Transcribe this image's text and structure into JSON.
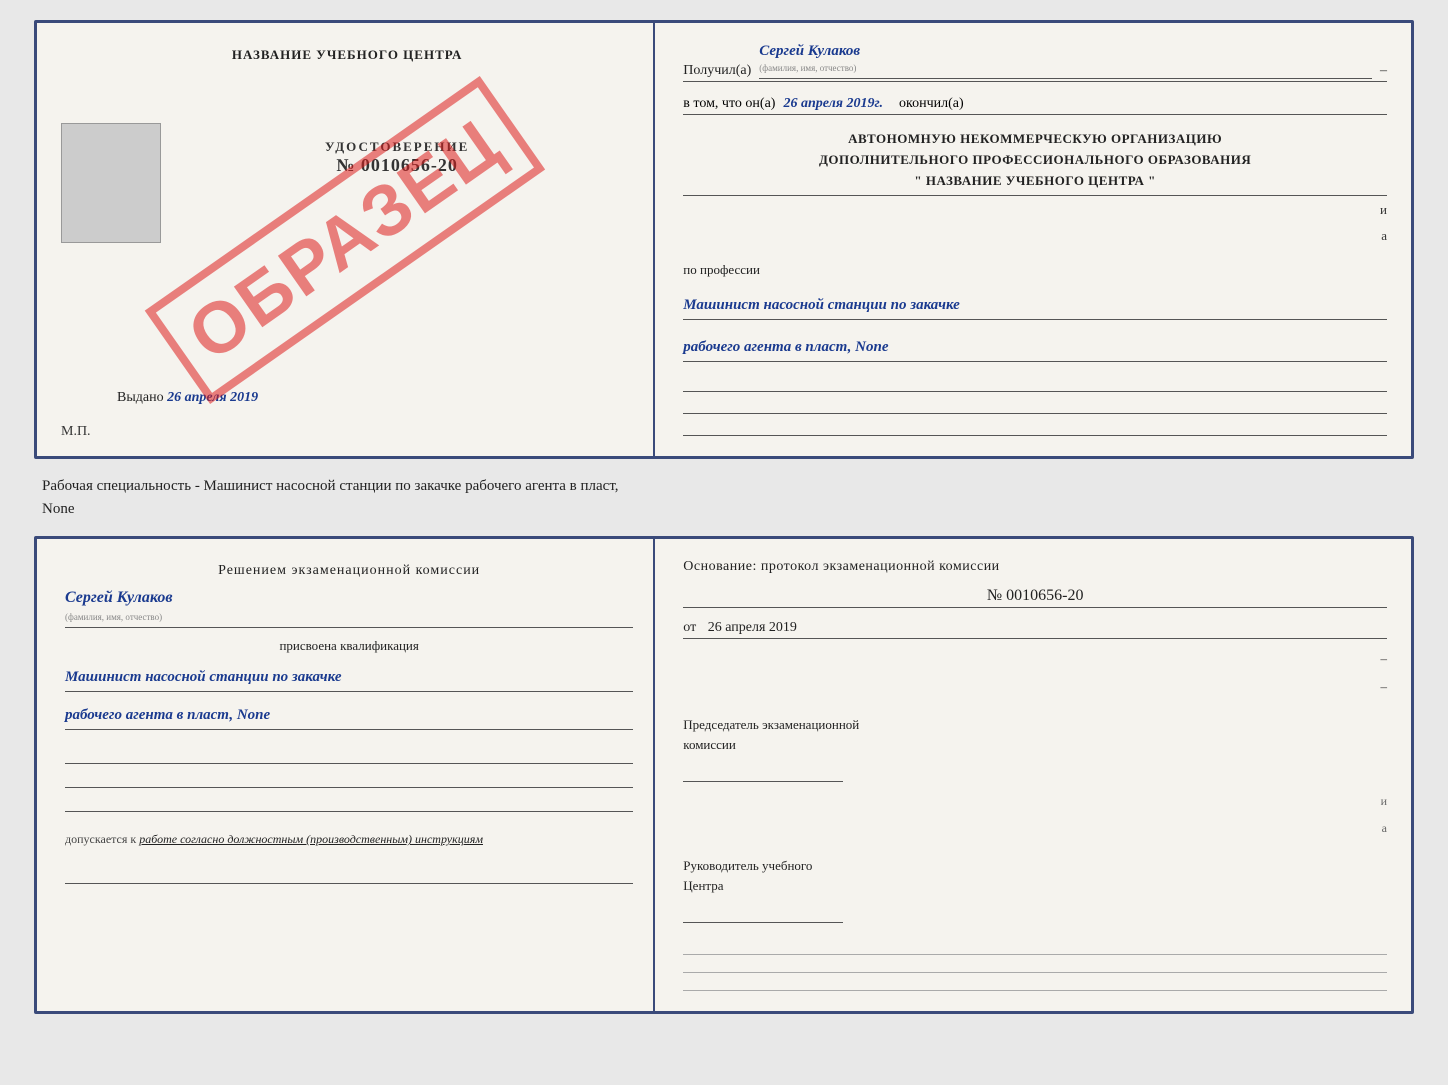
{
  "top_booklet": {
    "left": {
      "center_title": "НАЗВАНИЕ УЧЕБНОГО ЦЕНТРА",
      "udc_label": "УДОСТОВЕРЕНИЕ",
      "udc_number": "№ 0010656-20",
      "vydano_label": "Выдано",
      "vydano_date": "26 апреля 2019",
      "mp_label": "М.П.",
      "watermark": "ОБРАЗЕЦ"
    },
    "right": {
      "poluchil_label": "Получил(а)",
      "poluchil_value": "Сергей Кулаков",
      "poluchil_sub": "(фамилия, имя, отчество)",
      "dash1": "–",
      "vtom_label": "в том, что он(а)",
      "vtom_date": "26 апреля 2019г.",
      "okonchil_label": "окончил(а)",
      "org_line1": "АВТОНОМНУЮ НЕКОММЕРЧЕСКУЮ ОРГАНИЗАЦИЮ",
      "org_line2": "ДОПОЛНИТЕЛЬНОГО ПРОФЕССИОНАЛЬНОГО ОБРАЗОВАНИЯ",
      "org_line3": "\" НАЗВАНИЕ УЧЕБНОГО ЦЕНТРА \"",
      "dash_i": "и",
      "dash_a": "а",
      "po_professii": "по профессии",
      "profession_line1": "Машинист насосной станции по закачке",
      "profession_line2": "рабочего агента в пласт, None"
    }
  },
  "middle_text": {
    "line1": "Рабочая специальность - Машинист насосной станции по закачке рабочего агента в пласт,",
    "line2": "None"
  },
  "bottom_booklet": {
    "left": {
      "resolution_title": "Решением  экзаменационной  комиссии",
      "name_value": "Сергей Кулаков",
      "name_sub": "(фамилия, имя, отчество)",
      "prisvoena": "присвоена квалификация",
      "qual_line1": "Машинист насосной станции по закачке",
      "qual_line2": "рабочего агента в пласт, None",
      "dopuskaetsya_label": "допускается к",
      "dopuskaetsya_value": "работе согласно должностным (производственным) инструкциям"
    },
    "right": {
      "osnov_label": "Основание: протокол экзаменационной  комиссии",
      "protocol_number": "№  0010656-20",
      "ot_label": "от",
      "ot_date": "26 апреля 2019",
      "chairman_label1": "Председатель экзаменационной",
      "chairman_label2": "комиссии",
      "rukovoditel_label1": "Руководитель учебного",
      "rukovoditel_label2": "Центра"
    }
  }
}
